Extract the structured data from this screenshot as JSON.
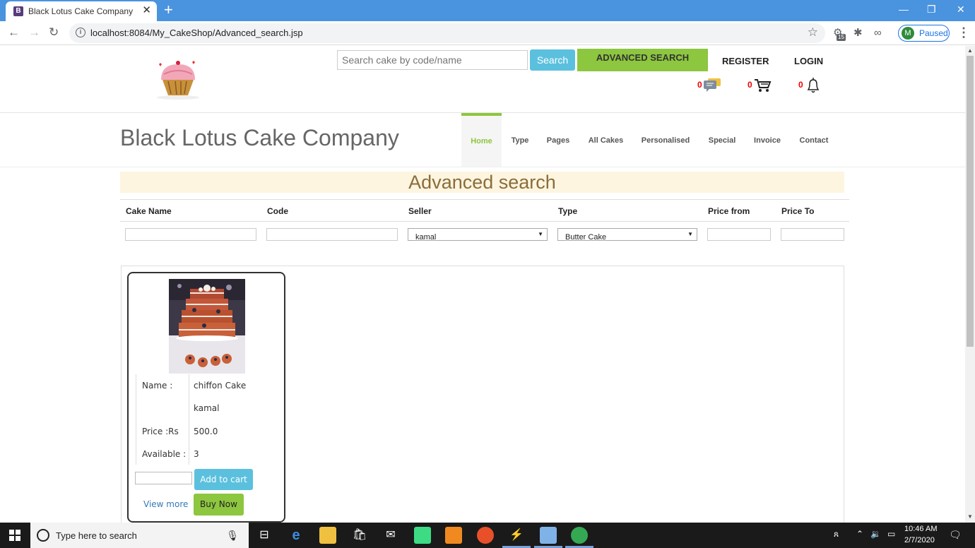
{
  "browser": {
    "tab_title": "Black Lotus Cake Company",
    "tab_favicon_letter": "B",
    "url": "localhost:8084/My_CakeShop/Advanced_search.jsp",
    "extension_badge": "15",
    "profile_initial": "M",
    "profile_label": "Paused"
  },
  "header": {
    "search_placeholder": "Search cake by code/name",
    "search_button": "Search",
    "advanced_search_button": "ADVANCED SEARCH",
    "register_link": "REGISTER",
    "login_link": "LOGIN",
    "message_count": "0",
    "cart_count": "0",
    "notification_count": "0"
  },
  "site": {
    "title": "Black Lotus Cake Company"
  },
  "nav": {
    "items": [
      {
        "label": "Home",
        "active": true
      },
      {
        "label": "Type"
      },
      {
        "label": "Pages"
      },
      {
        "label": "All Cakes"
      },
      {
        "label": "Personalised"
      },
      {
        "label": "Special"
      },
      {
        "label": "Invoice"
      },
      {
        "label": "Contact"
      }
    ]
  },
  "advanced_search": {
    "title": "Advanced search",
    "columns": [
      "Cake Name",
      "Code",
      "Seller",
      "Type",
      "Price from",
      "Price To"
    ],
    "seller_selected": "kamal",
    "type_selected": "Butter Cake",
    "cake_name_value": "",
    "code_value": "",
    "price_from_value": "",
    "price_to_value": ""
  },
  "result_card": {
    "name_label": "Name :",
    "name_value": "chiffon Cake",
    "seller_value": "kamal",
    "price_label": "Price :Rs",
    "price_value": "500.0",
    "available_label": "Available :",
    "available_value": "3",
    "quantity_value": "",
    "add_to_cart": "Add to cart",
    "view_more": "View more",
    "buy_now": "Buy Now"
  },
  "taskbar": {
    "search_text": "Type here to search",
    "time": "10:46 AM",
    "date": "2/7/2020"
  },
  "colors": {
    "browser_titlebar": "#4a93df",
    "accent_green": "#8dc63f",
    "accent_blue": "#5bc0de",
    "banner_bg": "#fdf5e0",
    "banner_text": "#8b6d3a",
    "counter_red": "#ee0000"
  }
}
